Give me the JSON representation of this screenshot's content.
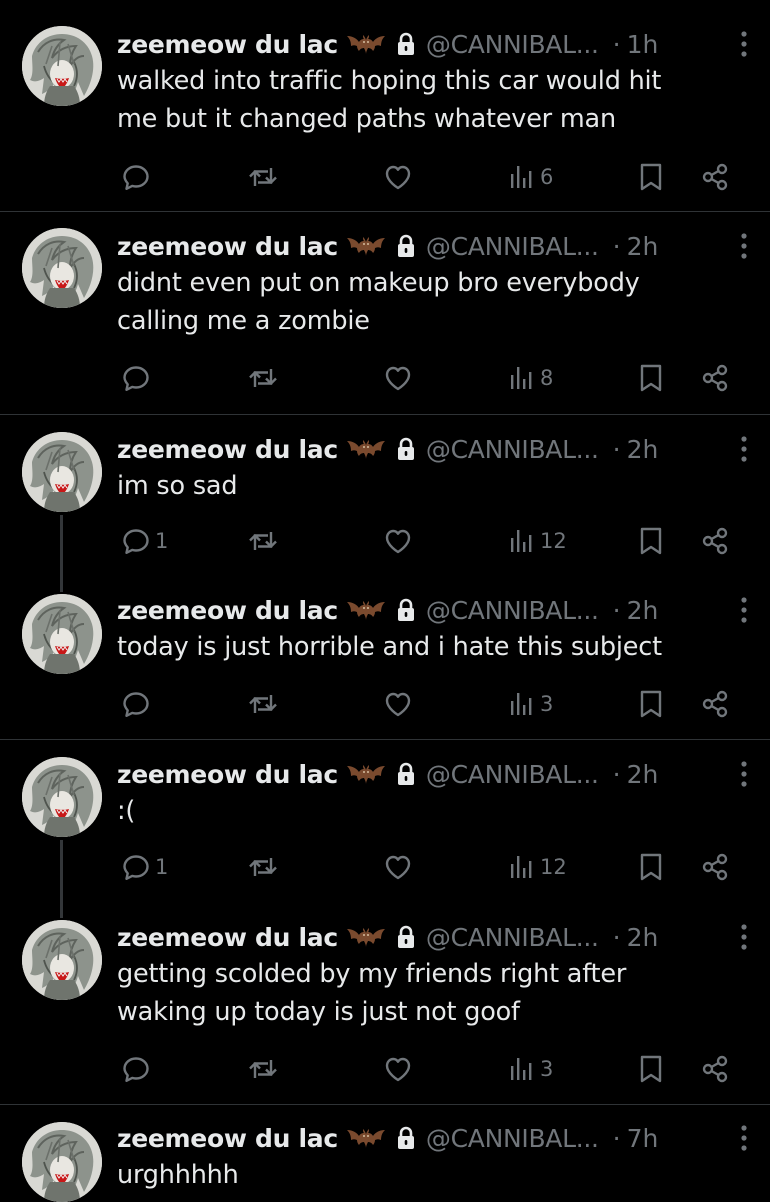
{
  "tweets": [
    {
      "name": "zeemeow du lac",
      "handle": "@CANNIBAL...",
      "dot": "·",
      "time": "1h",
      "lines": [
        "walked into traffic hoping this car would hit",
        "me but it changed paths whatever man"
      ],
      "replies": "",
      "views": "6"
    },
    {
      "name": "zeemeow du lac",
      "handle": "@CANNIBAL...",
      "dot": "·",
      "time": "2h",
      "lines": [
        "didnt even put on makeup bro everybody",
        "calling me a zombie"
      ],
      "replies": "",
      "views": "8"
    },
    {
      "name": "zeemeow du lac",
      "handle": "@CANNIBAL...",
      "dot": "·",
      "time": "2h",
      "lines": [
        "im so sad"
      ],
      "replies": "1",
      "views": "12"
    },
    {
      "name": "zeemeow du lac",
      "handle": "@CANNIBAL...",
      "dot": "·",
      "time": "2h",
      "lines": [
        "today is just horrible and i hate this subject"
      ],
      "replies": "",
      "views": "3"
    },
    {
      "name": "zeemeow du lac",
      "handle": "@CANNIBAL...",
      "dot": "·",
      "time": "2h",
      "lines": [
        ":("
      ],
      "replies": "1",
      "views": "12"
    },
    {
      "name": "zeemeow du lac",
      "handle": "@CANNIBAL...",
      "dot": "·",
      "time": "2h",
      "lines": [
        "getting scolded by my friends right after",
        "waking up today is just not goof"
      ],
      "replies": "",
      "views": "3"
    },
    {
      "name": "zeemeow du lac",
      "handle": "@CANNIBAL...",
      "dot": "·",
      "time": "7h",
      "lines": [
        "urghhhhh"
      ],
      "replies": "",
      "views": ""
    }
  ],
  "icons": {
    "name_emoji": "bat-icon",
    "protected": "lock-icon",
    "more": "more-vertical-icon",
    "reply": "reply-icon",
    "retweet": "retweet-icon",
    "like": "heart-icon",
    "views": "views-icon",
    "bookmark": "bookmark-icon",
    "share": "share-icon"
  },
  "colors": {
    "background": "#000000",
    "text": "#e7e9ea",
    "muted": "#71767b",
    "divider": "#2f3336"
  }
}
